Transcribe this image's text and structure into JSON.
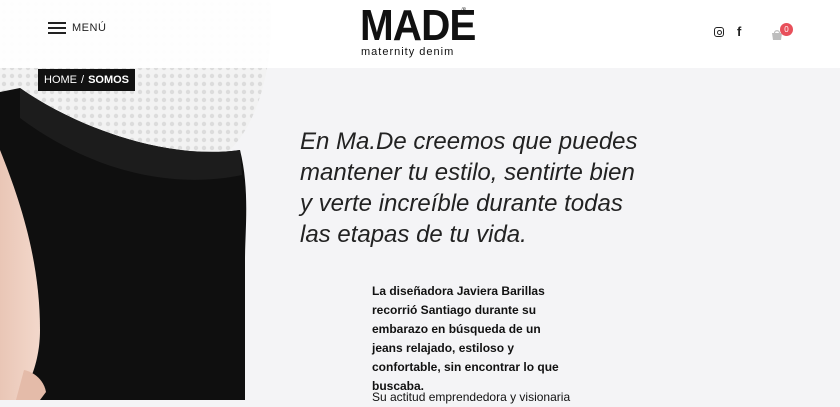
{
  "header": {
    "menu_label": "MENÚ",
    "logo": {
      "word": "MADE",
      "subtitle": "maternity denim",
      "trademark": "®"
    },
    "social": [
      "instagram-icon",
      "facebook-icon"
    ],
    "facebook_glyph": "f",
    "cart": {
      "icon": "bag-icon",
      "count": "0"
    }
  },
  "breadcrumb": {
    "home": "HOME",
    "separator": "/",
    "current": "SOMOS"
  },
  "intro": {
    "heading": "En Ma.De creemos que puedes mantener tu estilo, sentirte bien y verte increíble durante todas las etapas de tu vida."
  },
  "story": {
    "paragraph1": "La diseñadora Javiera Barillas recorrió Santiago durante su embarazo en búsqueda de un jeans relajado, estiloso y confortable, sin encontrar lo que buscaba.",
    "paragraph2": "Su actitud emprendedora y visionaria"
  },
  "colors": {
    "badge": "#e8505b",
    "breadcrumb_bg": "#111111",
    "page_bg": "#f4f4f6"
  }
}
